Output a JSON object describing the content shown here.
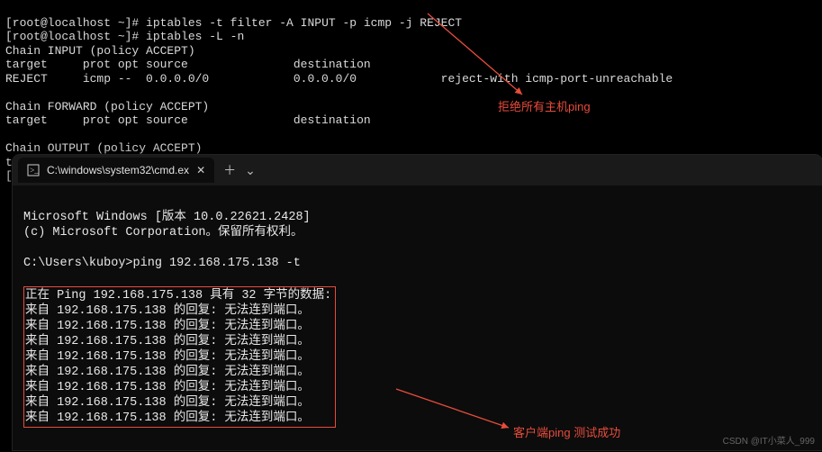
{
  "linux": {
    "prompt1": "[root@localhost ~]# ",
    "cmd1": "iptables -t filter -A INPUT -p icmp -j REJECT",
    "prompt2": "[root@localhost ~]# ",
    "cmd2": "iptables -L -n",
    "chain_input_header": "Chain INPUT (policy ACCEPT)",
    "cols_header": "target     prot opt source               destination         ",
    "rule_line": "REJECT     icmp --  0.0.0.0/0            0.0.0.0/0            reject-with icmp-port-unreachable",
    "blank": "",
    "chain_forward_header": "Chain FORWARD (policy ACCEPT)",
    "cols_header2": "target     prot opt source               destination         ",
    "chain_output_header": "Chain OUTPUT (policy ACCEPT)",
    "cutoff1": "ta",
    "cutoff2": "["
  },
  "win": {
    "tab_title": "C:\\windows\\system32\\cmd.ex",
    "banner1": "Microsoft Windows [版本 10.0.22621.2428]",
    "banner2": "(c) Microsoft Corporation。保留所有权利。",
    "prompt": "C:\\Users\\kuboy>",
    "cmd": "ping 192.168.175.138 -t",
    "ping_header": "正在 Ping 192.168.175.138 具有 32 字节的数据:",
    "reply": "来自 192.168.175.138 的回复: 无法连到端口。",
    "cursor": ""
  },
  "annotations": {
    "a1": "拒绝所有主机ping",
    "a2": "客户端ping 测试成功"
  },
  "watermark": "CSDN @IT小菜人_999"
}
